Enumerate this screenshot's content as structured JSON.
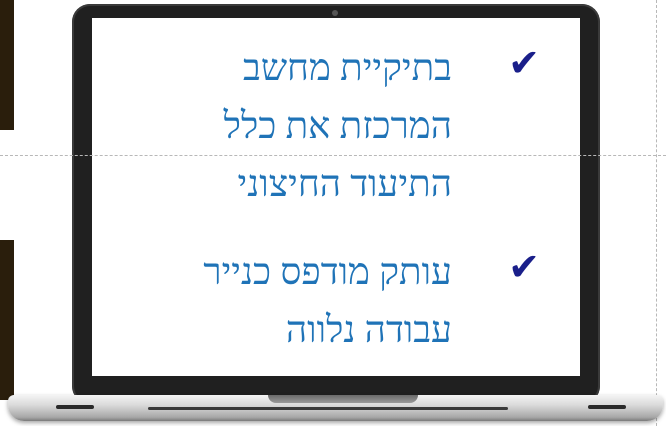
{
  "slide": {
    "bullets": [
      {
        "icon": "checkmark-icon",
        "glyph": "✔",
        "text": "בתיקיית מחשב המרכזת את כלל התיעוד החיצוני"
      },
      {
        "icon": "checkmark-icon",
        "glyph": "✔",
        "text": "עותק מודפס כנייר עבודה נלווה"
      }
    ]
  },
  "colors": {
    "text": "#1f73b7",
    "check": "#1a1f8a",
    "bezel": "#202020"
  }
}
